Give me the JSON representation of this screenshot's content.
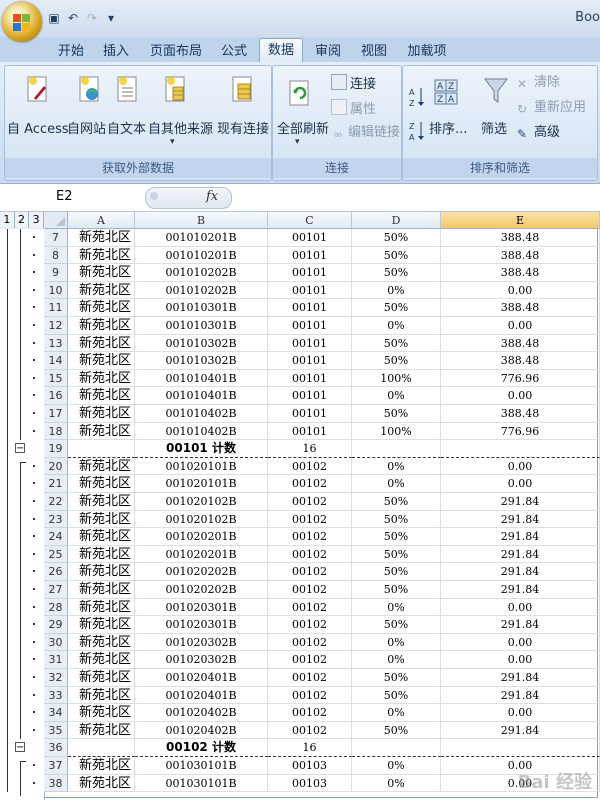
{
  "window": {
    "title": "Boo"
  },
  "quick_access": {
    "icons": [
      "save-icon",
      "undo-icon",
      "redo-icon",
      "customize-icon"
    ]
  },
  "tabs": [
    {
      "label": "开始"
    },
    {
      "label": "插入"
    },
    {
      "label": "页面布局"
    },
    {
      "label": "公式"
    },
    {
      "label": "数据",
      "active": true
    },
    {
      "label": "审阅"
    },
    {
      "label": "视图"
    },
    {
      "label": "加载项"
    }
  ],
  "ribbon": {
    "external": {
      "label": "获取外部数据",
      "buttons": [
        "自 Access",
        "自网站",
        "自文本",
        "自其他来源",
        "现有连接"
      ]
    },
    "connections": {
      "label": "连接",
      "refresh_all": "全部刷新",
      "items": [
        "连接",
        "属性",
        "编辑链接"
      ]
    },
    "sort_filter": {
      "label": "排序和筛选",
      "sort": "排序...",
      "filter": "筛选",
      "items": [
        "清除",
        "重新应用",
        "高级"
      ]
    }
  },
  "formula_bar": {
    "name_box": "E2",
    "fx_label": "fx",
    "formula": ""
  },
  "sheet": {
    "outline_levels": [
      "1",
      "2",
      "3"
    ],
    "columns": [
      "A",
      "B",
      "C",
      "D",
      "E"
    ],
    "selected_column": "E",
    "rows": [
      {
        "n": "7",
        "a": "新苑北区",
        "b": "001010201B",
        "c": "00101",
        "d": "50%",
        "e": "388.48"
      },
      {
        "n": "8",
        "a": "新苑北区",
        "b": "001010201B",
        "c": "00101",
        "d": "50%",
        "e": "388.48"
      },
      {
        "n": "9",
        "a": "新苑北区",
        "b": "001010202B",
        "c": "00101",
        "d": "50%",
        "e": "388.48"
      },
      {
        "n": "10",
        "a": "新苑北区",
        "b": "001010202B",
        "c": "00101",
        "d": "0%",
        "e": "0.00"
      },
      {
        "n": "11",
        "a": "新苑北区",
        "b": "001010301B",
        "c": "00101",
        "d": "50%",
        "e": "388.48"
      },
      {
        "n": "12",
        "a": "新苑北区",
        "b": "001010301B",
        "c": "00101",
        "d": "0%",
        "e": "0.00"
      },
      {
        "n": "13",
        "a": "新苑北区",
        "b": "001010302B",
        "c": "00101",
        "d": "50%",
        "e": "388.48"
      },
      {
        "n": "14",
        "a": "新苑北区",
        "b": "001010302B",
        "c": "00101",
        "d": "50%",
        "e": "388.48"
      },
      {
        "n": "15",
        "a": "新苑北区",
        "b": "001010401B",
        "c": "00101",
        "d": "100%",
        "e": "776.96"
      },
      {
        "n": "16",
        "a": "新苑北区",
        "b": "001010401B",
        "c": "00101",
        "d": "0%",
        "e": "0.00"
      },
      {
        "n": "17",
        "a": "新苑北区",
        "b": "001010402B",
        "c": "00101",
        "d": "50%",
        "e": "388.48"
      },
      {
        "n": "18",
        "a": "新苑北区",
        "b": "001010402B",
        "c": "00101",
        "d": "100%",
        "e": "776.96"
      },
      {
        "n": "19",
        "a": "",
        "b": "00101 计数",
        "c": "16",
        "d": "",
        "e": "",
        "subtotal": true
      },
      {
        "n": "20",
        "a": "新苑北区",
        "b": "001020101B",
        "c": "00102",
        "d": "0%",
        "e": "0.00"
      },
      {
        "n": "21",
        "a": "新苑北区",
        "b": "001020101B",
        "c": "00102",
        "d": "0%",
        "e": "0.00"
      },
      {
        "n": "22",
        "a": "新苑北区",
        "b": "001020102B",
        "c": "00102",
        "d": "50%",
        "e": "291.84"
      },
      {
        "n": "23",
        "a": "新苑北区",
        "b": "001020102B",
        "c": "00102",
        "d": "50%",
        "e": "291.84"
      },
      {
        "n": "24",
        "a": "新苑北区",
        "b": "001020201B",
        "c": "00102",
        "d": "50%",
        "e": "291.84"
      },
      {
        "n": "25",
        "a": "新苑北区",
        "b": "001020201B",
        "c": "00102",
        "d": "50%",
        "e": "291.84"
      },
      {
        "n": "26",
        "a": "新苑北区",
        "b": "001020202B",
        "c": "00102",
        "d": "50%",
        "e": "291.84"
      },
      {
        "n": "27",
        "a": "新苑北区",
        "b": "001020202B",
        "c": "00102",
        "d": "50%",
        "e": "291.84"
      },
      {
        "n": "28",
        "a": "新苑北区",
        "b": "001020301B",
        "c": "00102",
        "d": "0%",
        "e": "0.00"
      },
      {
        "n": "29",
        "a": "新苑北区",
        "b": "001020301B",
        "c": "00102",
        "d": "50%",
        "e": "291.84"
      },
      {
        "n": "30",
        "a": "新苑北区",
        "b": "001020302B",
        "c": "00102",
        "d": "0%",
        "e": "0.00"
      },
      {
        "n": "31",
        "a": "新苑北区",
        "b": "001020302B",
        "c": "00102",
        "d": "0%",
        "e": "0.00"
      },
      {
        "n": "32",
        "a": "新苑北区",
        "b": "001020401B",
        "c": "00102",
        "d": "50%",
        "e": "291.84"
      },
      {
        "n": "33",
        "a": "新苑北区",
        "b": "001020401B",
        "c": "00102",
        "d": "50%",
        "e": "291.84"
      },
      {
        "n": "34",
        "a": "新苑北区",
        "b": "001020402B",
        "c": "00102",
        "d": "0%",
        "e": "0.00"
      },
      {
        "n": "35",
        "a": "新苑北区",
        "b": "001020402B",
        "c": "00102",
        "d": "50%",
        "e": "291.84"
      },
      {
        "n": "36",
        "a": "",
        "b": "00102 计数",
        "c": "16",
        "d": "",
        "e": "",
        "subtotal": true
      },
      {
        "n": "37",
        "a": "新苑北区",
        "b": "001030101B",
        "c": "00103",
        "d": "0%",
        "e": "0.00"
      },
      {
        "n": "38",
        "a": "新苑北区",
        "b": "001030101B",
        "c": "00103",
        "d": "0%",
        "e": "0.00"
      }
    ]
  },
  "watermark": "Bai 经验"
}
